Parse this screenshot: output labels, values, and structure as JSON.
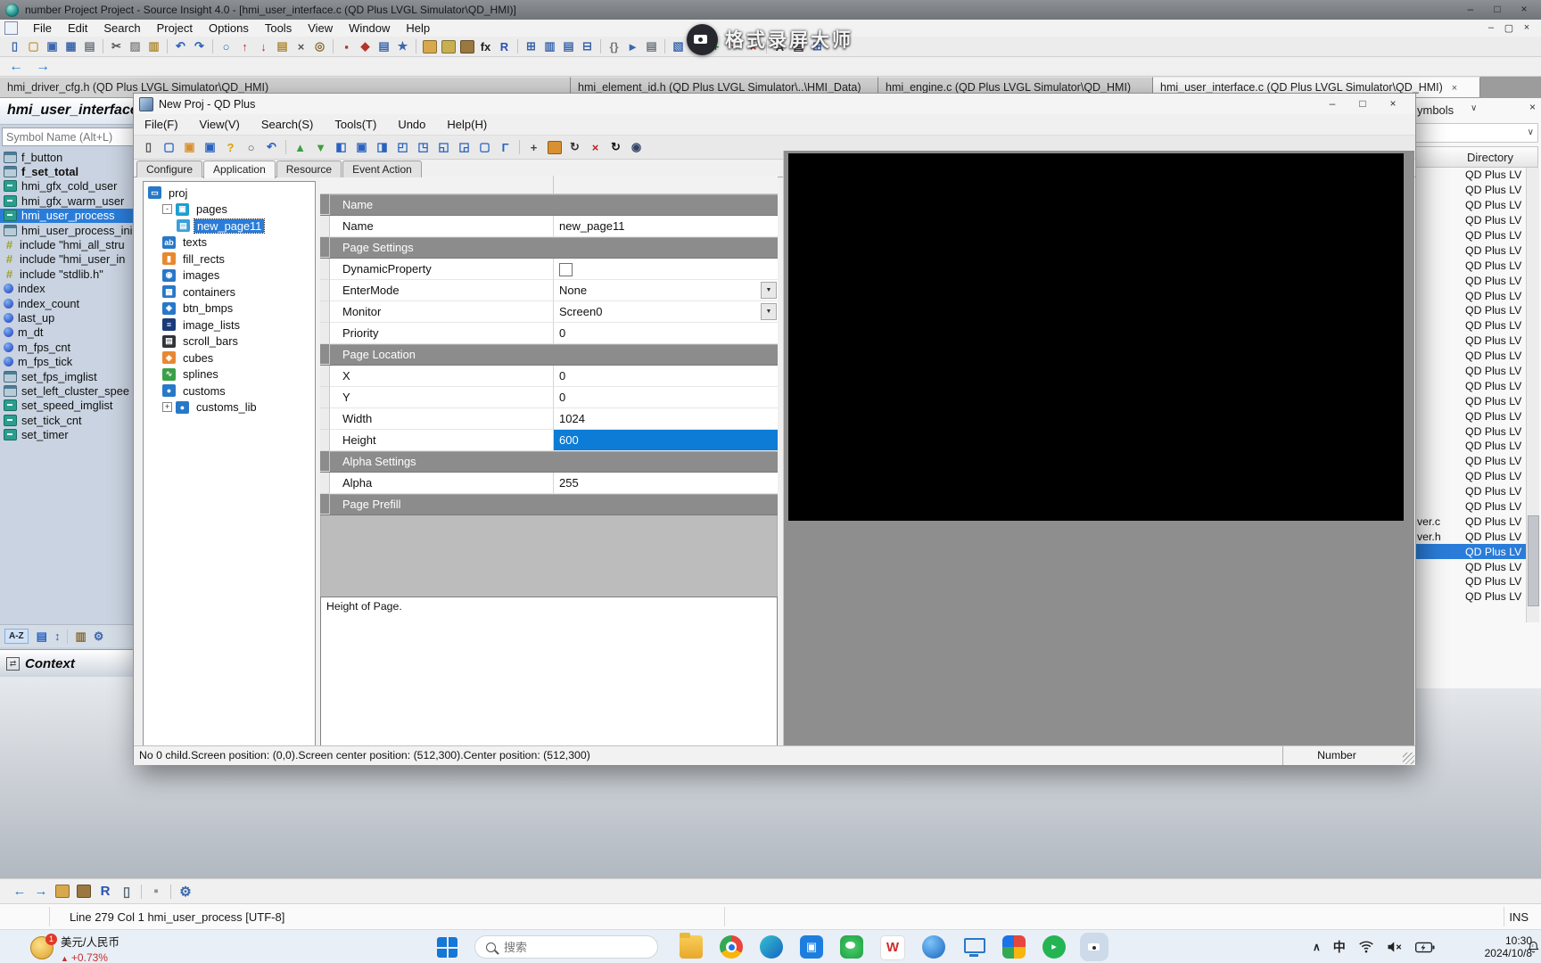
{
  "colors": {
    "selection_blue": "#2a7cd8",
    "grid_selection_blue": "#0c7cd6",
    "section_header_gray": "#8c8c8c",
    "backdrop_gray": "#828282",
    "stock_up_red": "#c43030",
    "taskbar_bg": "#e9eff6"
  },
  "titlebar": {
    "title": "number Project Project - Source Insight 4.0 - [hmi_user_interface.c (QD Plus LVGL Simulator\\QD_HMI)]",
    "controls": [
      "minimize",
      "maximize",
      "close"
    ]
  },
  "menubar": {
    "items": [
      "File",
      "Edit",
      "Search",
      "Project",
      "Options",
      "Tools",
      "View",
      "Window",
      "Help"
    ]
  },
  "si_toolbar": [
    [
      "new-file",
      "▯",
      "#3b66ad"
    ],
    [
      "open-folder",
      "▢",
      "#c49a3a"
    ],
    [
      "save",
      "▣",
      "#3b66ad"
    ],
    [
      "save-all",
      "▦",
      "#3b66ad"
    ],
    [
      "print",
      "▤",
      "#6e767e"
    ],
    [
      "sep"
    ],
    [
      "cut",
      "✂",
      "#555555"
    ],
    [
      "copy",
      "▨",
      "#888888"
    ],
    [
      "paste",
      "▥",
      "#b08a36"
    ],
    [
      "sep"
    ],
    [
      "undo",
      "↶",
      "#2a62be"
    ],
    [
      "redo",
      "↷",
      "#2a62be"
    ],
    [
      "sep"
    ],
    [
      "search",
      "○",
      "#2a62be"
    ],
    [
      "replace",
      "↑",
      "#b43428"
    ],
    [
      "replace-in-files",
      "↓",
      "#b43428"
    ],
    [
      "search-in-files",
      "▤",
      "#b08a36"
    ],
    [
      "token-search",
      "×",
      "#555555"
    ],
    [
      "browse-symbols",
      "◎",
      "#8a6a30"
    ],
    [
      "sep"
    ],
    [
      "bookmark",
      "▪",
      "#b43428"
    ],
    [
      "bookmark-list",
      "◆",
      "#b43428"
    ],
    [
      "file-list",
      "▤",
      "#3b66ad"
    ],
    [
      "favorites",
      "★",
      "#3b66ad"
    ],
    [
      "sep"
    ],
    [
      "symbol-hand",
      "",
      "#d8a84c"
    ],
    [
      "reference",
      "",
      "#c8b050"
    ],
    [
      "help-book",
      "",
      "#9a7840"
    ],
    [
      "function-fx",
      "fx",
      "#222222"
    ],
    [
      "script-r",
      "R",
      "#2a52b0"
    ],
    [
      "sep"
    ],
    [
      "table",
      "⊞",
      "#3b66ad"
    ],
    [
      "columns",
      "▥",
      "#3b66ad"
    ],
    [
      "rows",
      "▤",
      "#3b66ad"
    ],
    [
      "split",
      "⊟",
      "#3b66ad"
    ],
    [
      "sep"
    ],
    [
      "braces",
      "{}",
      "#777777"
    ],
    [
      "indent-right",
      "►",
      "#3b66ad"
    ],
    [
      "align",
      "▤",
      "#6e767e"
    ],
    [
      "sep"
    ],
    [
      "cascade",
      "▧",
      "#3b66ad"
    ],
    [
      "tile",
      "▦",
      "#3b66ad"
    ],
    [
      "zoom-in",
      "+",
      "#2a8a2a"
    ],
    [
      "zoom-out",
      "−",
      "#b43428"
    ],
    [
      "close-file",
      "×",
      "#c02020"
    ],
    [
      "sep"
    ],
    [
      "char-a",
      "A",
      "#333333"
    ],
    [
      "symbol-window",
      "▤",
      "#333333"
    ],
    [
      "relation-window",
      "⊞",
      "#3b66ad"
    ]
  ],
  "recorder": {
    "label": "格式录屏大师"
  },
  "tabs": [
    {
      "label": "hmi_driver_cfg.h (QD Plus LVGL Simulator\\QD_HMI)",
      "active": false
    },
    {
      "label": "hmi_element_id.h (QD Plus LVGL Simulator\\..\\HMI_Data)",
      "active": false
    },
    {
      "label": "hmi_engine.c (QD Plus LVGL Simulator\\QD_HMI)",
      "active": false
    },
    {
      "label": "hmi_user_interface.c (QD Plus LVGL Simulator\\QD_HMI)",
      "active": true,
      "close_glyph": "×"
    }
  ],
  "sidebar": {
    "header": "hmi_user_interface",
    "search_placeholder": "Symbol Name (Alt+L)",
    "symbols": [
      {
        "label": "f_button",
        "type": "fn"
      },
      {
        "label": "f_set_total",
        "type": "fn",
        "bold": true
      },
      {
        "label": "hmi_gfx_cold_user",
        "type": "fn2"
      },
      {
        "label": "hmi_gfx_warm_user",
        "type": "fn2"
      },
      {
        "label": "hmi_user_process",
        "type": "fn2",
        "selected": true
      },
      {
        "label": "hmi_user_process_ini",
        "type": "fn"
      },
      {
        "label": "include \"hmi_all_stru",
        "type": "inc"
      },
      {
        "label": "include \"hmi_user_in",
        "type": "inc"
      },
      {
        "label": "include \"stdlib.h\"",
        "type": "inc"
      },
      {
        "label": "index",
        "type": "var"
      },
      {
        "label": "index_count",
        "type": "var"
      },
      {
        "label": "last_up",
        "type": "var"
      },
      {
        "label": "m_dt",
        "type": "var"
      },
      {
        "label": "m_fps_cnt",
        "type": "var"
      },
      {
        "label": "m_fps_tick",
        "type": "var"
      },
      {
        "label": "set_fps_imglist",
        "type": "fn"
      },
      {
        "label": "set_left_cluster_spee",
        "type": "fn"
      },
      {
        "label": "set_speed_imglist",
        "type": "fn2"
      },
      {
        "label": "set_tick_cnt",
        "type": "fn2"
      },
      {
        "label": "set_timer",
        "type": "fn2"
      }
    ],
    "tools": [
      [
        "sort-alpha",
        "A-Z"
      ],
      [
        "list-view",
        "▤",
        "#2a62be"
      ],
      [
        "sort-type",
        "↕",
        "#2a62be"
      ],
      [
        "sep"
      ],
      [
        "help-book",
        "▥",
        "#8a6a30"
      ],
      [
        "options-gear",
        "⚙",
        "#3b66ad"
      ]
    ],
    "context_title": "Context"
  },
  "right_panel": {
    "header": "ymbols",
    "chevron": "∨",
    "close_glyph": "×",
    "column": "Directory",
    "dir_label": "QD Plus LV",
    "row_count": 29,
    "file_rows": {
      "23": "ver.c",
      "24": "ver.h"
    },
    "selected_index": 25
  },
  "qd": {
    "title": "New Proj - QD Plus",
    "controls": [
      "minimize",
      "maximize",
      "close"
    ],
    "menu": [
      "File(F)",
      "View(V)",
      "Search(S)",
      "Tools(T)",
      "Undo",
      "Help(H)"
    ],
    "toolbar": [
      [
        "new-page",
        "▯",
        "#555555"
      ],
      [
        "open",
        "▢",
        "#2a62be"
      ],
      [
        "save",
        "▣",
        "#d89030"
      ],
      [
        "edit-form",
        "▣",
        "#2a62be"
      ],
      [
        "help",
        "?",
        "#d8a000"
      ],
      [
        "zoom",
        "○",
        "#555555"
      ],
      [
        "undo",
        "↶",
        "#2a62be"
      ],
      [
        "sep"
      ],
      [
        "move-up",
        "▲",
        "#3aa03a"
      ],
      [
        "move-down",
        "▼",
        "#3aa03a"
      ],
      [
        "align-left",
        "◧",
        "#2a62be"
      ],
      [
        "align-center-h",
        "▣",
        "#2a62be"
      ],
      [
        "align-right",
        "◨",
        "#2a62be"
      ],
      [
        "align-top",
        "◰",
        "#2a62be"
      ],
      [
        "align-middle",
        "◳",
        "#2a62be"
      ],
      [
        "align-bottom",
        "◱",
        "#2a62be"
      ],
      [
        "same-width",
        "◲",
        "#2a62be"
      ],
      [
        "same-height",
        "▢",
        "#2a62be"
      ],
      [
        "corner",
        "Γ",
        "#2a62be"
      ],
      [
        "sep"
      ],
      [
        "move-cross",
        "+",
        "#444444"
      ],
      [
        "pan-hand",
        "",
        "#d89030"
      ],
      [
        "rotate",
        "↻",
        "#333333"
      ],
      [
        "delete",
        "×",
        "#c02020"
      ],
      [
        "refresh",
        "↻",
        "#111111"
      ],
      [
        "preview-eye",
        "◉",
        "#334466"
      ]
    ],
    "tabs": [
      {
        "label": "Configure",
        "active": false
      },
      {
        "label": "Application",
        "active": true
      },
      {
        "label": "Resource",
        "active": false
      },
      {
        "label": "Event Action",
        "active": false
      }
    ],
    "tree": [
      {
        "label": "proj",
        "level": 0,
        "icon": "project"
      },
      {
        "label": "pages",
        "level": 1,
        "icon": "pages",
        "exp": "-"
      },
      {
        "label": "new_page11",
        "level": 2,
        "icon": "page",
        "selected": true
      },
      {
        "label": "texts",
        "level": 1,
        "icon": "texts"
      },
      {
        "label": "fill_rects",
        "level": 1,
        "icon": "fill-rects"
      },
      {
        "label": "images",
        "level": 1,
        "icon": "images"
      },
      {
        "label": "containers",
        "level": 1,
        "icon": "containers"
      },
      {
        "label": "btn_bmps",
        "level": 1,
        "icon": "btn-bmps"
      },
      {
        "label": "image_lists",
        "level": 1,
        "icon": "image-lists"
      },
      {
        "label": "scroll_bars",
        "level": 1,
        "icon": "scroll-bars"
      },
      {
        "label": "cubes",
        "level": 1,
        "icon": "cubes"
      },
      {
        "label": "splines",
        "level": 1,
        "icon": "splines"
      },
      {
        "label": "customs",
        "level": 1,
        "icon": "customs"
      },
      {
        "label": "customs_lib",
        "level": 1,
        "icon": "customs-lib",
        "exp": "+"
      }
    ],
    "props": [
      {
        "k": "section",
        "label": "Name"
      },
      {
        "k": "text",
        "label": "Name",
        "value": "new_page11"
      },
      {
        "k": "section",
        "label": "Page Settings"
      },
      {
        "k": "check",
        "label": "DynamicProperty",
        "checked": false
      },
      {
        "k": "drop",
        "label": "EnterMode",
        "value": "None"
      },
      {
        "k": "drop",
        "label": "Monitor",
        "value": "Screen0"
      },
      {
        "k": "text",
        "label": "Priority",
        "value": "0"
      },
      {
        "k": "section",
        "label": "Page Location"
      },
      {
        "k": "text",
        "label": "X",
        "value": "0"
      },
      {
        "k": "text",
        "label": "Y",
        "value": "0"
      },
      {
        "k": "text",
        "label": "Width",
        "value": "1024"
      },
      {
        "k": "text",
        "label": "Height",
        "value": "600",
        "selected": true
      },
      {
        "k": "section",
        "label": "Alpha Settings"
      },
      {
        "k": "text",
        "label": "Alpha",
        "value": "255"
      },
      {
        "k": "section",
        "label": "Page Prefill"
      }
    ],
    "description": "Height of Page.",
    "status_left": "No 0 child.Screen position: (0,0).Screen center position: (512,300).Center position: (512,300)",
    "status_right": "Number"
  },
  "bottom_toolbar": [
    [
      "back",
      "←",
      "#1f7ad0"
    ],
    [
      "forward",
      "→",
      "#1f7ad0"
    ],
    [
      "symbol-hand",
      "",
      "#d8a84c"
    ],
    [
      "help-book",
      "",
      "#9a7840"
    ],
    [
      "script-r",
      "R",
      "#2a52b0"
    ],
    [
      "doc",
      "▯",
      "#556677"
    ],
    [
      "sep"
    ],
    [
      "lock",
      "▪",
      "#8a9098"
    ],
    [
      "sep"
    ],
    [
      "settings-gear",
      "⚙",
      "#3b66ad"
    ]
  ],
  "bottom": {
    "status": "Line 279  Col 1   hmi_user_process [UTF-8]",
    "ins": "INS"
  },
  "taskbar": {
    "stock": {
      "name": "美元/人民币",
      "change": "+0.73%",
      "badge": "1",
      "up_glyph": "▲"
    },
    "search_placeholder": "搜索",
    "apps": [
      "file-explorer",
      "chrome",
      "edge",
      "store",
      "wechat",
      "wps",
      "browser-sphere",
      "monitor",
      "app-grid",
      "green-app",
      "recorder"
    ],
    "active_app": "recorder",
    "tray": [
      "chevron-up",
      "ime",
      "wifi",
      "volume-muted",
      "battery-charging"
    ],
    "ime": "中",
    "chevron": "∧",
    "time": "10:30",
    "date": "2024/10/8"
  }
}
